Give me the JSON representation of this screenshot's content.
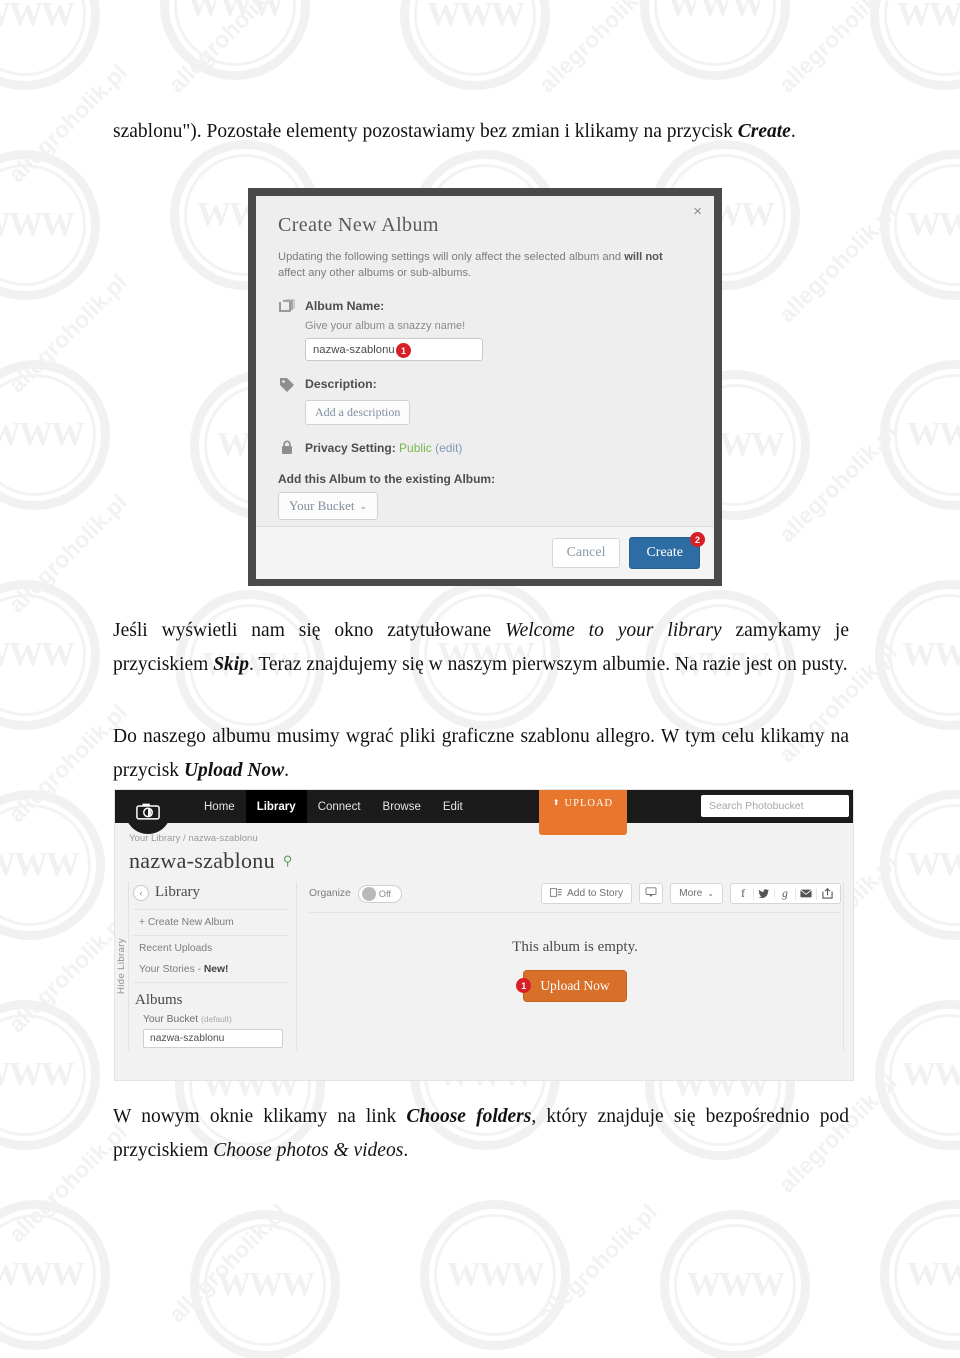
{
  "document": {
    "paragraphs": {
      "p1_a": "szablonu\"). Pozostałe elementy pozostawiamy bez zmian i klikamy na przycisk ",
      "p1_b": "Create",
      "p1_c": ".",
      "p2_a": "Jeśli wyświetli nam się okno zatytułowane ",
      "p2_b": "Welcome to your library",
      "p2_c": " zamykamy je przyciskiem ",
      "p2_d": "Skip",
      "p2_e": ". Teraz znajdujemy się w naszym pierwszym albumie. Na razie jest on pusty.",
      "p3_a": "Do naszego albumu musimy wgrać pliki graficzne szablonu allegro. W tym celu klikamy na przycisk ",
      "p3_b": "Upload Now",
      "p3_c": ".",
      "p4_a": "W nowym oknie klikamy na link ",
      "p4_b": "Choose folders",
      "p4_c": ", który znajduje się bezpośrednio pod przyciskiem ",
      "p4_d": "Choose photos & videos",
      "p4_e": "."
    },
    "watermark": {
      "text": "allegroholik.pl",
      "stamp": "WWW"
    }
  },
  "figure1_dialog": {
    "close_label": "×",
    "title": "Create New Album",
    "note_a": "Updating the following settings will only affect the selected album and ",
    "note_b": "will not",
    "note_c": " affect any other albums or sub-albums.",
    "album_name_label": "Album Name:",
    "album_name_hint": "Give your album a snazzy name!",
    "album_name_value": "nazwa-szablonu",
    "album_name_badge": "1",
    "description_label": "Description:",
    "description_button": "Add a description",
    "privacy_label": "Privacy Setting:",
    "privacy_value": "Public",
    "privacy_edit": "(edit)",
    "add_to_album_label": "Add this Album to the existing Album:",
    "bucket_select_value": "Your Bucket",
    "bucket_caret": "⌄",
    "cancel_label": "Cancel",
    "create_label": "Create",
    "create_badge": "2",
    "colors": {
      "dialog_bg": "#eeeeee",
      "frame": "#4a4a4a",
      "create_blue": "#2e6da4",
      "badge_red": "#d81f28",
      "public_green": "#76b852"
    }
  },
  "figure2_photobucket": {
    "nav": {
      "logo": "camera-logo",
      "items": [
        {
          "label": "Home",
          "active": false
        },
        {
          "label": "Library",
          "active": true
        },
        {
          "label": "Connect",
          "active": false
        },
        {
          "label": "Browse",
          "active": false
        },
        {
          "label": "Edit",
          "active": false
        }
      ],
      "upload_label": "UPLOAD",
      "upload_arrow": "⬆",
      "search_placeholder": "Search Photobucket"
    },
    "breadcrumb": {
      "root": "Your Library",
      "separator": "/",
      "current": "nazwa-szablonu"
    },
    "page_title": "nazwa-szablonu",
    "pin_icon": "⚲",
    "sidebar": {
      "rail_label": "Hide Library",
      "collapse_icon": "‹",
      "heading": "Library",
      "links": [
        "+ Create New Album",
        "Recent Uploads"
      ],
      "stories_label": "Your Stories - ",
      "stories_new": "New!",
      "albums_heading": "Albums",
      "bucket_label": "Your Bucket",
      "bucket_default": "(default)",
      "album_value": "nazwa-szablonu"
    },
    "toolbar": {
      "organize_label": "Organize",
      "organize_state": "Off",
      "add_to_story": "Add to Story",
      "slideshow_icon": "slideshow-icon",
      "more_label": "More",
      "more_caret": "⌄",
      "social": [
        "f",
        "🐦",
        "g",
        "✉",
        "↗"
      ]
    },
    "empty_state": {
      "message": "This album is empty.",
      "upload_button": "Upload Now",
      "upload_badge": "1"
    },
    "colors": {
      "nav_bg": "#1b1b1b",
      "upload_orange": "#e8762c",
      "button_orange": "#d9702a",
      "page_bg": "#f2f2f2"
    }
  }
}
